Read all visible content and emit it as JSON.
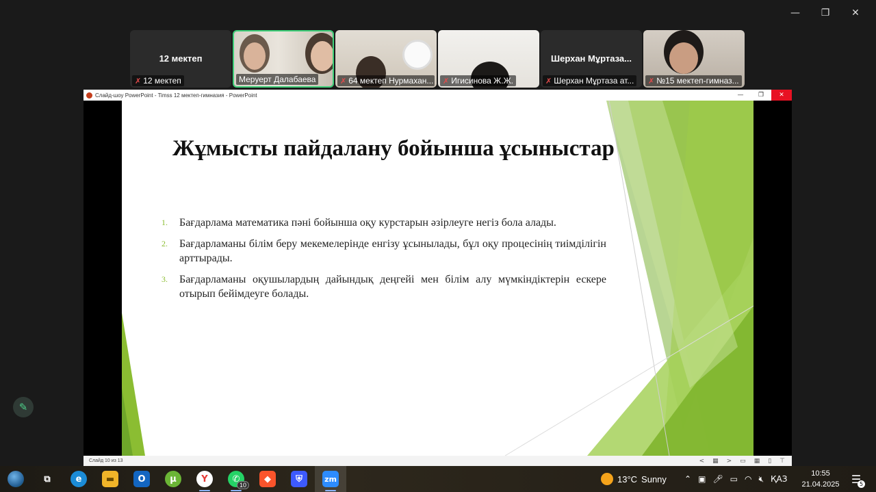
{
  "window_controls": {
    "minimize": "—",
    "restore": "❐",
    "close": "✕"
  },
  "participants": [
    {
      "display_name": "12 мектеп",
      "nameplate": "12 мектеп",
      "muted": true,
      "video": false
    },
    {
      "display_name": "",
      "nameplate": "Меруерт Далабаева",
      "muted": false,
      "video": true,
      "active_speaker": true
    },
    {
      "display_name": "",
      "nameplate": "64 мектеп Нурмахан...",
      "muted": true,
      "video": true
    },
    {
      "display_name": "",
      "nameplate": "Игисинова Ж.Ж.",
      "muted": true,
      "video": true
    },
    {
      "display_name": "Шерхан Мұртаза...",
      "nameplate": "Шерхан Мұртаза ат...",
      "muted": true,
      "video": false
    },
    {
      "display_name": "",
      "nameplate": "№15 мектеп-гимназ...",
      "muted": true,
      "video": true
    }
  ],
  "ppt": {
    "window_title": "Слайд-шоу PowerPoint  -  Timss 12 мектеп-гимназия  -  PowerPoint",
    "status_text": "Слайд 10 из 13",
    "nav": {
      "prev": "<",
      "grid": "▦",
      "next": ">"
    },
    "slide": {
      "title": "Жұмысты пайдалану бойынша ұсыныстар",
      "items": [
        {
          "num": "1.",
          "text": "Бағдарлама математика пәні бойынша оқу курстарын әзірлеуге негіз бола алады."
        },
        {
          "num": "2.",
          "text": "Бағдарламаны білім беру мекемелерінде енгізу ұсынылады, бұл оқу процесінің тиімділігін арттырады."
        },
        {
          "num": "3.",
          "text": "Бағдарламаны оқушылардың дайындық деңгейі мен білім алу мүмкіндіктерін ескере отырып бейімдеуге болады."
        }
      ],
      "accent_color": "#8bbd32"
    }
  },
  "annotate_icon": "pencil-icon",
  "taskbar": {
    "apps": [
      {
        "name": "globe-icon",
        "label": "",
        "color": "#2a6fb0"
      },
      {
        "name": "task-view-icon",
        "label": "⧉",
        "color": "transparent"
      },
      {
        "name": "edge-icon",
        "label": "e",
        "color": "#1b8bd6"
      },
      {
        "name": "file-explorer-icon",
        "label": "▬",
        "color": "#f0b429"
      },
      {
        "name": "outlook-icon",
        "label": "O",
        "color": "#1366c1"
      },
      {
        "name": "utorrent-icon",
        "label": "µ",
        "color": "#6bb536"
      },
      {
        "name": "yandex-browser-icon",
        "label": "Y",
        "color": "#e53935"
      },
      {
        "name": "whatsapp-icon",
        "label": "✆",
        "color": "#25d366",
        "badge": "10"
      },
      {
        "name": "brave-icon",
        "label": "◆",
        "color": "#fb542b"
      },
      {
        "name": "shield-app-icon",
        "label": "⛨",
        "color": "#3d5afe"
      },
      {
        "name": "zoom-icon",
        "label": "zm",
        "color": "#2d8cff"
      }
    ],
    "weather": {
      "temp": "13°C",
      "condition": "Sunny"
    },
    "tray": {
      "chevron": "⌃",
      "language": "ҚАЗ"
    },
    "clock": {
      "time": "10:55",
      "date": "21.04.2025"
    },
    "notifications": "5"
  }
}
